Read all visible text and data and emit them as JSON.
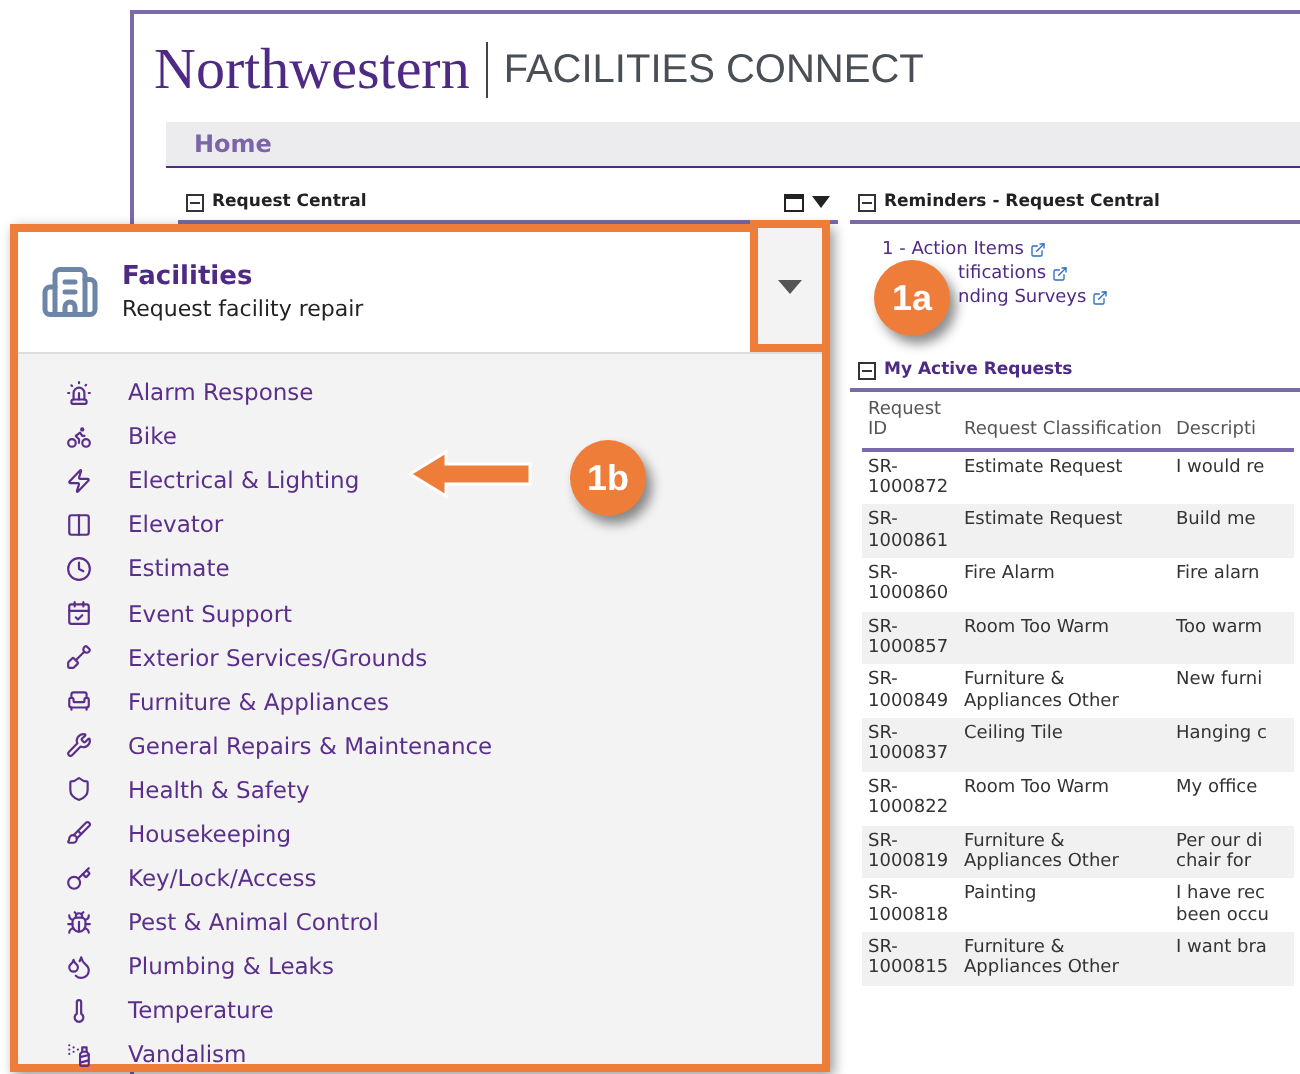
{
  "header": {
    "logo": "Northwestern",
    "product": "FACILITIES CONNECT"
  },
  "nav": [
    {
      "label": "Home",
      "selected": true
    }
  ],
  "request_central": {
    "title": "Request Central"
  },
  "reminders": {
    "title": "Reminders - Request Central",
    "items": [
      {
        "label": "1 - Action Items",
        "partly_hidden": false
      },
      {
        "label": "tifications",
        "partly_hidden": true
      },
      {
        "label": "nding Surveys",
        "partly_hidden": true
      }
    ]
  },
  "active_requests": {
    "title": "My Active Requests",
    "columns": [
      "Request ID",
      "Request Classification",
      "Descripti"
    ],
    "rows": [
      [
        "SR-1000872",
        "Estimate Request",
        "I would re"
      ],
      [
        "SR-1000861",
        "Estimate Request",
        "Build me"
      ],
      [
        "SR-1000860",
        "Fire Alarm",
        "Fire alarn"
      ],
      [
        "SR-1000857",
        "Room Too Warm",
        "Too warm"
      ],
      [
        "SR-1000849",
        "Furniture & Appliances Other",
        "New furni"
      ],
      [
        "SR-1000837",
        "Ceiling Tile",
        "Hanging c"
      ],
      [
        "SR-1000822",
        "Room Too Warm",
        "My office"
      ],
      [
        "SR-1000819",
        "Furniture & Appliances Other",
        "Per our di chair for"
      ],
      [
        "SR-1000818",
        "Painting",
        "I have rec been occu"
      ],
      [
        "SR-1000815",
        "Furniture & Appliances Other",
        "I want bra"
      ]
    ]
  },
  "callout": {
    "title": "Facilities",
    "subtitle": "Request facility repair",
    "items": [
      "Alarm Response",
      "Bike",
      "Electrical & Lighting",
      "Elevator",
      "Estimate",
      "Event Support",
      "Exterior Services/Grounds",
      "Furniture & Appliances",
      "General Repairs & Maintenance",
      "Health & Safety",
      "Housekeeping",
      "Key/Lock/Access",
      "Pest & Animal Control",
      "Plumbing & Leaks",
      "Temperature",
      "Vandalism"
    ]
  },
  "badges": [
    "1a",
    "1b"
  ]
}
